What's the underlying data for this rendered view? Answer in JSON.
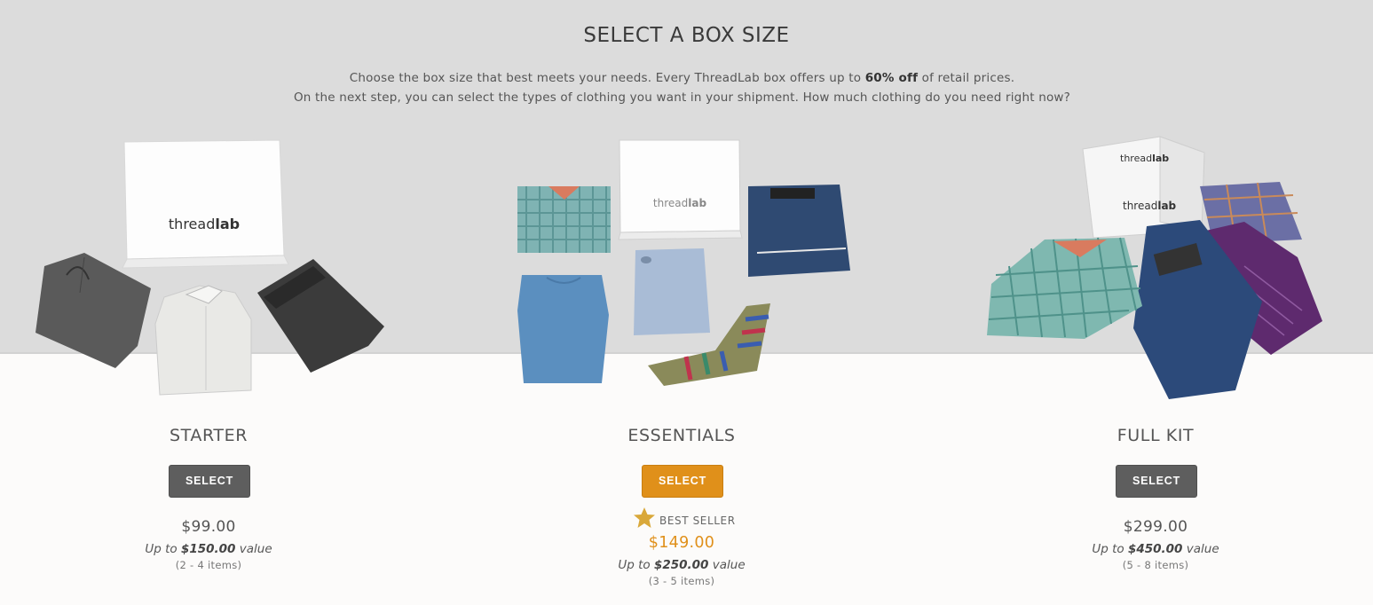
{
  "header": {
    "title": "SELECT A BOX SIZE",
    "line1_pre": "Choose the box size that best meets your needs. Every ThreadLab box offers up to ",
    "line1_bold": "60% off",
    "line1_post": " of retail prices.",
    "line2": "On the next step, you can select the types of clothing you want in your shipment. How much clothing do you need right now?"
  },
  "brand": {
    "logo_thin": "thread",
    "logo_bold": "lab"
  },
  "colors": {
    "accent": "#e0901a",
    "button_gray": "#5e5e5e",
    "band_gray": "#dcdcdc",
    "star": "#d9a83a"
  },
  "boxes": [
    {
      "name": "STARTER",
      "select_label": "SELECT",
      "price": "$99.00",
      "value_pre": "Up to ",
      "value_amount": "$150.00",
      "value_post": " value",
      "items": "(2 - 4 items)"
    },
    {
      "name": "ESSENTIALS",
      "select_label": "SELECT",
      "badge_label": "BEST SELLER",
      "badge_icon": "star-icon",
      "price": "$149.00",
      "value_pre": "Up to ",
      "value_amount": "$250.00",
      "value_post": " value",
      "items": "(3 - 5 items)"
    },
    {
      "name": "FULL KIT",
      "select_label": "SELECT",
      "price": "$299.00",
      "value_pre": "Up to ",
      "value_amount": "$450.00",
      "value_post": " value",
      "items": "(5 - 8 items)"
    }
  ]
}
